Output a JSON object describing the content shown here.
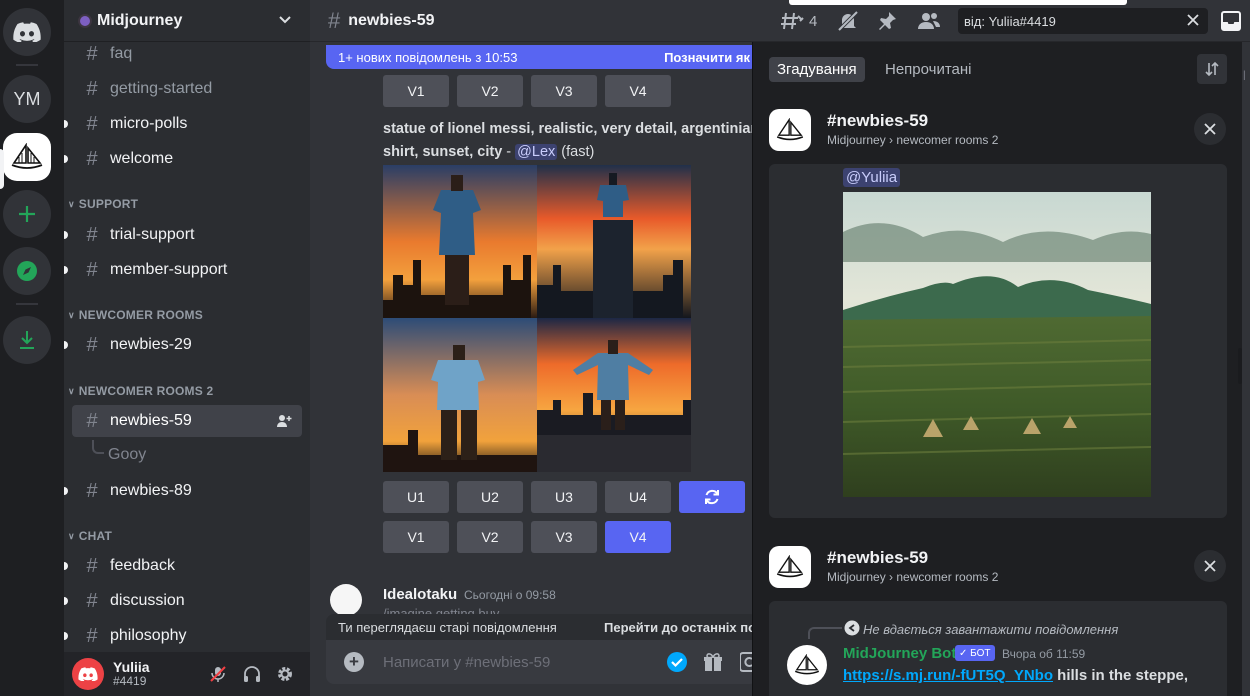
{
  "rail": {
    "items": [
      {
        "name": "discord-home",
        "label": ""
      },
      {
        "name": "server-ym",
        "label": "YM"
      },
      {
        "name": "server-midjourney",
        "label": ""
      },
      {
        "name": "add-server",
        "label": ""
      },
      {
        "name": "explore",
        "label": ""
      },
      {
        "name": "download-apps",
        "label": ""
      }
    ]
  },
  "sidebar": {
    "guild_name": "Midjourney",
    "channels_top": [
      {
        "label": "faq"
      },
      {
        "label": "getting-started"
      },
      {
        "label": "micro-polls"
      },
      {
        "label": "welcome"
      }
    ],
    "categories": {
      "support": "SUPPORT",
      "newcomer": "NEWCOMER ROOMS",
      "newcomer2": "NEWCOMER ROOMS 2",
      "chat": "CHAT"
    },
    "support_channels": [
      {
        "label": "trial-support"
      },
      {
        "label": "member-support"
      }
    ],
    "newcomer_channels": [
      {
        "label": "newbies-29"
      }
    ],
    "newcomer2_channels": [
      {
        "label": "newbies-59"
      },
      {
        "label": "newbies-89"
      }
    ],
    "thread": "Gooy",
    "chat_channels": [
      {
        "label": "feedback"
      },
      {
        "label": "discussion"
      },
      {
        "label": "philosophy"
      }
    ]
  },
  "user": {
    "name": "Yuliia",
    "tag": "#4419"
  },
  "chat": {
    "channel": "newbies-59",
    "new_messages_bar": "1+ нових повідомлень з 10:53",
    "mark_read": "Позначити як",
    "top_buttons": [
      "V1",
      "V2",
      "V3",
      "V4"
    ],
    "prompt_bold": "statue of lionel messi, realistic, very detail, argentinian shirt, sunset, city",
    "prompt_dash": " - ",
    "prompt_mention": "@Lex",
    "prompt_suffix": " (fast)",
    "upscale_buttons": [
      "U1",
      "U2",
      "U3",
      "U4"
    ],
    "variation_buttons": [
      "V1",
      "V2",
      "V3",
      "V4"
    ],
    "msg2_author": "Idealotaku",
    "msg2_time": "Сьогодні о 09:58",
    "msg2_body": "/imagine getting buy...",
    "old_messages_bar": "Ти переглядаєш старі повідомлення",
    "jump_latest": "Перейти до останніх по",
    "composer_placeholder": "Написати у #newbies-59"
  },
  "toolbar": {
    "threads_count": "4",
    "search_value": "від: Yuliia#4419"
  },
  "inbox": {
    "tabs": [
      "Згадування",
      "Непрочитані"
    ],
    "cards": [
      {
        "title": "newbies-59",
        "subtitle": "Midjourney › newcomer rooms 2"
      },
      {
        "title": "newbies-59",
        "subtitle": "Midjourney › newcomer rooms 2"
      }
    ],
    "mention": "@Yuliia",
    "reply_failed": "Не вдається завантажити повідомлення",
    "bot_name": "MidJourney Bot",
    "bot_badge": "БОТ",
    "bot_time": "Вчора об 11:59",
    "bot_link": "https://s.mj.run/-fUT5Q_YNbo",
    "bot_text": " hills in the steppe,"
  },
  "colors": {
    "blurple": "#5865f2",
    "bot_green": "#23a559",
    "link": "#00a8fc"
  }
}
